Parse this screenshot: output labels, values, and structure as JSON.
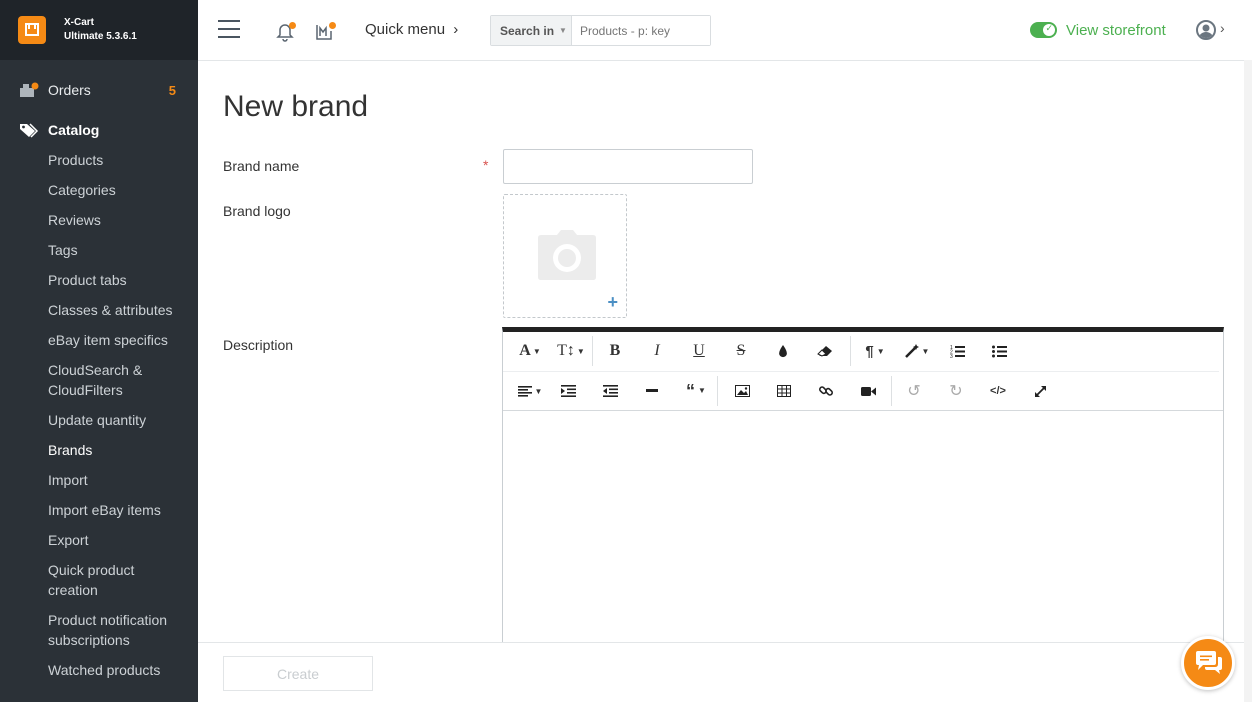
{
  "app": {
    "name": "X-Cart",
    "version": "Ultimate 5.3.6.1"
  },
  "sidebar": {
    "orders": {
      "label": "Orders",
      "count": "5"
    },
    "catalog": {
      "label": "Catalog"
    },
    "items": [
      "Products",
      "Categories",
      "Reviews",
      "Tags",
      "Product tabs",
      "Classes & attributes",
      "eBay item specifics",
      "CloudSearch & CloudFilters",
      "Update quantity",
      "Brands",
      "Import",
      "Import eBay items",
      "Export",
      "Quick product creation",
      "Product notification subscriptions",
      "Watched products"
    ]
  },
  "header": {
    "quick_menu": "Quick menu",
    "search_in": "Search in",
    "search_placeholder": "Products - p: key",
    "view_storefront": "View storefront"
  },
  "page": {
    "title": "New brand",
    "brand_name_label": "Brand name",
    "required_mark": "*",
    "brand_logo_label": "Brand logo",
    "description_label": "Description",
    "create_button": "Create"
  },
  "editor": {
    "row1": [
      "font",
      "font-size",
      "bold",
      "italic",
      "underline",
      "strikethrough",
      "color",
      "eraser",
      "paragraph",
      "magic-format",
      "ordered-list",
      "unordered-list"
    ],
    "row2": [
      "align",
      "indent",
      "outdent",
      "horizontal-rule",
      "quote",
      "image",
      "table",
      "link",
      "video",
      "undo",
      "redo",
      "code-view",
      "fullscreen"
    ]
  },
  "colors": {
    "sidebar_bg": "#2b3137",
    "accent": "#f58a15",
    "success": "#4cb050",
    "link": "#4b8fc4"
  }
}
